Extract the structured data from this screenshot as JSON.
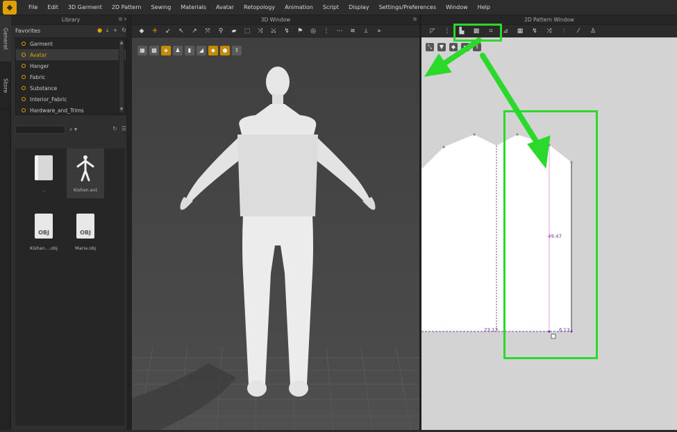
{
  "menubar": {
    "items": [
      "File",
      "Edit",
      "3D Garment",
      "2D Pattern",
      "Sewing",
      "Materials",
      "Avatar",
      "Retopology",
      "Animation",
      "Script",
      "Display",
      "Settings/Preferences",
      "Window",
      "Help"
    ]
  },
  "side_tabs": [
    "General",
    "Store"
  ],
  "library": {
    "title": "Library",
    "favorites_label": "Favorites",
    "favorites": [
      "Garment",
      "Avatar",
      "Hanger",
      "Fabric",
      "Substance",
      "Interior_Fabric",
      "Hardware_and_Trims"
    ],
    "selected_favorite": "Avatar",
    "search_placeholder": "",
    "files": [
      {
        "name": "..",
        "kind": "folder"
      },
      {
        "name": "Kishan.avt",
        "kind": "avatar"
      },
      {
        "name": "Kishan....obj",
        "kind": "obj"
      },
      {
        "name": "Maria.obj",
        "kind": "obj"
      }
    ],
    "obj_badge": "OBJ"
  },
  "window3d": {
    "title": "3D Window"
  },
  "window2d": {
    "title": "2D Pattern Window",
    "measurements": {
      "height": "49.47",
      "bottom_left": "23.13",
      "bottom_right": "6.13"
    }
  },
  "colors": {
    "accent": "#e0a100",
    "highlight": "#2bd92b",
    "measure": "#7a3da0"
  }
}
